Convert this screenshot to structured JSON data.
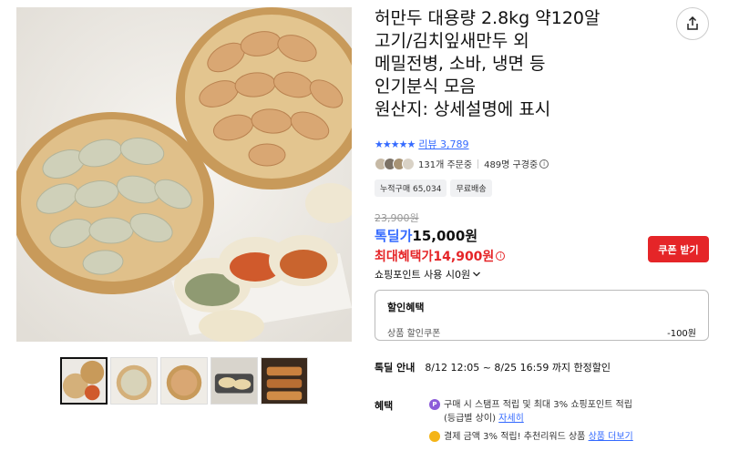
{
  "product": {
    "title_lines": [
      "허만두 대용량 2.8kg 약120알",
      "고기/김치잎새만두 외",
      "메밀전병, 소바, 냉면 등",
      "인기분식 모음",
      "원산지: 상세설명에 표시"
    ]
  },
  "rating": {
    "stars": "★★★★★",
    "review_label": "리뷰 3,789"
  },
  "buyers": {
    "orders": "131개 주문중",
    "subscribers": "489명 구경중"
  },
  "chips": [
    "누적구매 65,034",
    "무료배송"
  ],
  "price": {
    "original": "23,900원",
    "deal_label": "톡딜가",
    "deal_price": "15,000원",
    "max_benefit": "최대혜택가14,900원",
    "coupon_button": "쿠폰 받기"
  },
  "points": {
    "label": "쇼핑포인트 사용 시0원"
  },
  "discount": {
    "title": "할인혜택",
    "line_label": "상품 할인쿠폰",
    "line_amount": "-100원"
  },
  "special": {
    "label": "톡딜 안내",
    "text": "8/12 12:05 ~ 8/25 16:59 까지 한정할인"
  },
  "benefit": {
    "label": "혜택",
    "line1": "구매 시 스탬프 적립 및 최대 3% 쇼핑포인트 적립",
    "line2_prefix": "(등급별 상이)",
    "line2_link": "자세히",
    "line3_prefix": "결제 금액 3% 적립! 추천리워드 상품",
    "line3_link": "상품 더보기",
    "p_badge": "P"
  },
  "icons": {
    "share": "share-icon",
    "chevron": "chevron-down-icon",
    "info": "i"
  },
  "colors": {
    "accent_blue": "#346aff",
    "accent_red": "#e52528"
  }
}
